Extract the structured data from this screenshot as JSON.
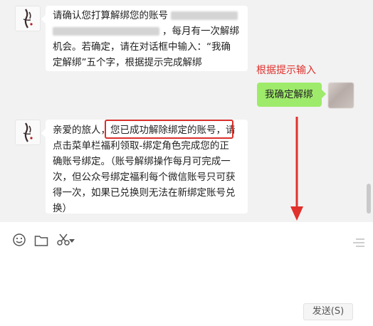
{
  "messages": [
    {
      "from": "other",
      "lines": [
        "请确认您打算解绑您的账号",
        "，每月有一次解绑",
        "机会。若确定，请在对话框中输入：“我确",
        "定解绑”五个字，根据提示完成解绑"
      ]
    },
    {
      "from": "self",
      "text": "我确定解绑"
    },
    {
      "from": "other",
      "lines": [
        "亲爱的旅人，",
        "您已成功解除绑定的账号，",
        "请",
        "点击菜单栏福利领取-绑定角色完成您的正",
        "确账号绑定。（账号解绑操作每月可完成一",
        "次，但公众号绑定福利每个微信账号只可获",
        "得一次，如果已兑换则无法在新绑定账号兑",
        "换）"
      ]
    }
  ],
  "annotation": "根据提示输入",
  "colors": {
    "chat_bg": "#f2f2f2",
    "self_bubble": "#9eea6a",
    "annotation_red": "#e0312c"
  },
  "toolbar": {
    "icons": [
      "emoji-icon",
      "folder-icon",
      "scissors-icon",
      "chevron-down-icon",
      "history-icon"
    ]
  },
  "send_button_label": "发送(S)"
}
